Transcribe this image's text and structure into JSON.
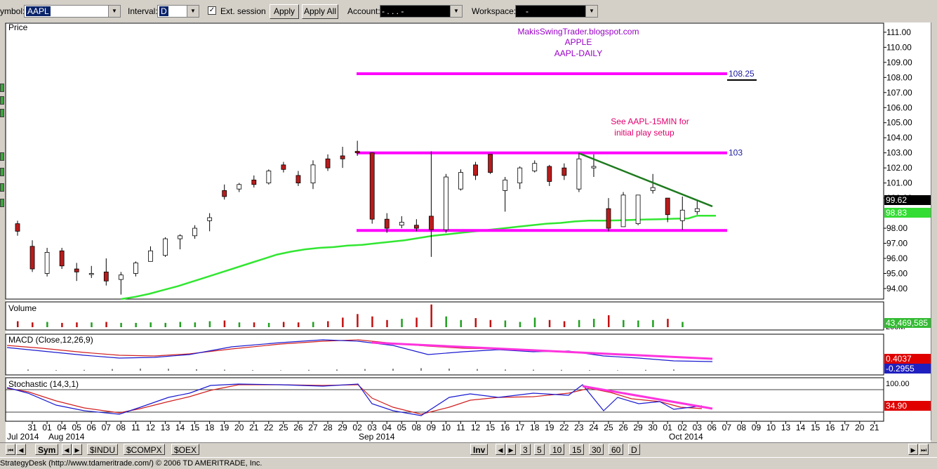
{
  "toolbar": {
    "symbol_label": "Symbol:",
    "symbol_value": "AAPL",
    "interval_label": "Interval:",
    "interval_value": "D",
    "ext_session_label": "Ext. session",
    "apply_label": "Apply",
    "apply_all_label": "Apply All",
    "account_label": "Account:",
    "account_value": "- .   .   .   -",
    "workspace_label": "Workspace:",
    "workspace_value": "-"
  },
  "chart_data": [
    {
      "type": "candlestick",
      "panel": "price",
      "title_lines": [
        "MakisSwingTrader.blogspot.com",
        "APPLE",
        "AAPL-DAILY"
      ],
      "panel_label": "Price",
      "annotation_lines": [
        "See AAPL-15MIN for",
        "initial play setup"
      ],
      "y_ticks": [
        "111.00",
        "110.00",
        "109.00",
        "108.00",
        "107.00",
        "106.00",
        "105.00",
        "104.00",
        "103.00",
        "102.00",
        "101.00",
        "100.00",
        "98.00",
        "97.00",
        "96.00",
        "95.00",
        "94.00"
      ],
      "ylim": [
        93.3,
        111.6
      ],
      "dates": [
        "Jul 31",
        "Aug 01",
        "Aug 04",
        "Aug 05",
        "Aug 06",
        "Aug 07",
        "Aug 08",
        "Aug 11",
        "Aug 12",
        "Aug 13",
        "Aug 14",
        "Aug 15",
        "Aug 18",
        "Aug 19",
        "Aug 20",
        "Aug 21",
        "Aug 22",
        "Aug 25",
        "Aug 26",
        "Aug 27",
        "Aug 28",
        "Aug 29",
        "Sep 02",
        "Sep 03",
        "Sep 04",
        "Sep 05",
        "Sep 08",
        "Sep 09",
        "Sep 10",
        "Sep 11",
        "Sep 12",
        "Sep 15",
        "Sep 16",
        "Sep 17",
        "Sep 18",
        "Sep 19",
        "Sep 22",
        "Sep 23",
        "Sep 24",
        "Sep 25",
        "Sep 26",
        "Sep 29",
        "Sep 30",
        "Oct 01",
        "Oct 02",
        "Oct 03"
      ],
      "ohlc": [
        [
          98.3,
          98.5,
          97.5,
          97.8
        ],
        [
          96.8,
          97.2,
          95.1,
          95.3
        ],
        [
          95.0,
          96.7,
          94.8,
          96.4
        ],
        [
          96.5,
          96.7,
          95.3,
          95.5
        ],
        [
          95.3,
          95.7,
          94.5,
          95.1
        ],
        [
          95.0,
          95.5,
          94.7,
          95.0
        ],
        [
          95.1,
          96.0,
          94.2,
          94.5
        ],
        [
          94.6,
          95.1,
          93.6,
          94.9
        ],
        [
          95.0,
          95.8,
          94.8,
          95.7
        ],
        [
          95.8,
          96.8,
          95.8,
          96.5
        ],
        [
          96.2,
          97.4,
          96.1,
          97.3
        ],
        [
          97.3,
          97.6,
          96.6,
          97.5
        ],
        [
          97.5,
          98.2,
          97.3,
          98.0
        ],
        [
          98.5,
          99.0,
          97.8,
          98.7
        ],
        [
          100.5,
          100.9,
          99.9,
          100.1
        ],
        [
          100.6,
          101.0,
          100.4,
          100.9
        ],
        [
          101.2,
          101.5,
          100.7,
          100.9
        ],
        [
          101.0,
          101.9,
          100.9,
          101.8
        ],
        [
          102.2,
          102.4,
          101.7,
          101.9
        ],
        [
          101.5,
          101.8,
          100.8,
          101.0
        ],
        [
          101.0,
          102.5,
          100.6,
          102.2
        ],
        [
          102.6,
          102.9,
          101.8,
          102.0
        ],
        [
          102.8,
          103.4,
          102.0,
          102.6
        ],
        [
          103.1,
          103.8,
          102.8,
          103.0
        ],
        [
          103.0,
          103.0,
          98.3,
          98.6
        ],
        [
          98.6,
          99.0,
          97.7,
          98.0
        ],
        [
          98.2,
          98.8,
          98.0,
          98.4
        ],
        [
          98.2,
          98.6,
          97.8,
          98.0
        ],
        [
          98.8,
          103.1,
          96.1,
          97.9
        ],
        [
          97.9,
          101.6,
          97.7,
          101.4
        ],
        [
          100.6,
          101.9,
          100.5,
          101.7
        ],
        [
          102.2,
          102.4,
          101.2,
          101.5
        ],
        [
          102.9,
          102.9,
          101.6,
          101.7
        ],
        [
          100.5,
          101.4,
          99.1,
          101.2
        ],
        [
          101.0,
          102.1,
          100.6,
          102.0
        ],
        [
          101.8,
          102.5,
          101.7,
          102.3
        ],
        [
          102.1,
          102.2,
          100.8,
          101.1
        ],
        [
          102.0,
          102.3,
          101.2,
          101.5
        ],
        [
          100.6,
          103.0,
          100.4,
          102.6
        ],
        [
          102.0,
          102.9,
          101.4,
          102.1
        ],
        [
          99.3,
          100.0,
          97.8,
          98.0
        ],
        [
          98.1,
          100.4,
          98.1,
          100.2
        ],
        [
          98.3,
          100.2,
          98.2,
          100.2
        ],
        [
          100.5,
          101.6,
          100.3,
          100.7
        ],
        [
          100.0,
          100.0,
          98.4,
          98.9
        ],
        [
          98.5,
          100.1,
          97.9,
          99.2
        ],
        [
          99.1,
          99.9,
          98.9,
          99.3
        ]
      ],
      "ma_label_value": "98.83",
      "last_price": "99.62",
      "hlines": [
        {
          "label": "108.25",
          "value": 108.25
        },
        {
          "label": "103",
          "value": 103.0
        },
        {
          "label": "",
          "value": 97.85
        }
      ],
      "colors": {
        "up": "#ffffff",
        "down": "#b81c1c",
        "ma": "#32e632",
        "hline": "#ff00ff",
        "trend": "#1e7a1e"
      }
    },
    {
      "type": "bar",
      "panel": "volume",
      "panel_label": "Volume",
      "y_ticks": [
        "200M"
      ],
      "last_value": "43,469,585"
    },
    {
      "type": "line",
      "panel": "macd",
      "panel_label": "MACD (Close,12,26,9)",
      "last_values": [
        "0.4037",
        "-0.2955"
      ]
    },
    {
      "type": "line",
      "panel": "stochastic",
      "panel_label": "Stochastic (14,3,1)",
      "y_ticks": [
        "100.00"
      ],
      "last_value": "34.90"
    }
  ],
  "x_axis": {
    "day_labels": [
      "31",
      "01",
      "04",
      "05",
      "06",
      "07",
      "08",
      "11",
      "12",
      "13",
      "14",
      "15",
      "18",
      "19",
      "20",
      "21",
      "22",
      "25",
      "26",
      "27",
      "28",
      "29",
      "02",
      "03",
      "04",
      "05",
      "08",
      "09",
      "10",
      "11",
      "12",
      "15",
      "16",
      "17",
      "18",
      "19",
      "22",
      "23",
      "24",
      "25",
      "26",
      "29",
      "30",
      "01",
      "02",
      "03",
      "06",
      "07",
      "08",
      "09",
      "10",
      "13",
      "14",
      "15",
      "16",
      "17",
      "20",
      "21"
    ],
    "month_labels": [
      {
        "text": "Jul 2014"
      },
      {
        "text": "Aug 2014"
      },
      {
        "text": "Sep 2014"
      },
      {
        "text": "Oct 2014"
      }
    ]
  },
  "bottom_tabs": {
    "sym_label": "Sym",
    "symbols": [
      "$INDU",
      "$COMPX",
      "$OEX"
    ],
    "inv_label": "Inv",
    "intervals": [
      "3",
      "5",
      "10",
      "15",
      "30",
      "60",
      "D"
    ]
  },
  "status_text": "StrategyDesk (http://www.tdameritrade.com/) © 2006 TD AMERITRADE, Inc."
}
